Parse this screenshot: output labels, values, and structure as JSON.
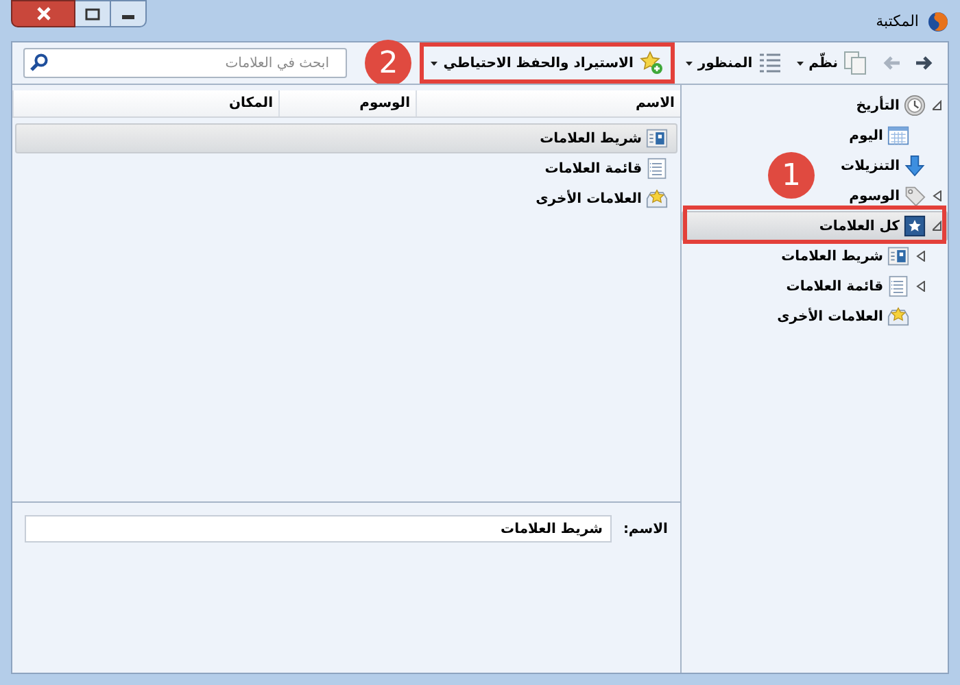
{
  "window": {
    "title": "المكتبة"
  },
  "toolbar": {
    "back": {
      "disabled": false
    },
    "forward": {
      "disabled": true
    },
    "buttons": [
      {
        "kind": "organize",
        "label": "نظّم",
        "has_menu": true
      },
      {
        "kind": "views",
        "label": "المنظور",
        "has_menu": true
      },
      {
        "kind": "import",
        "label": "الاستيراد والحفظ الاحتياطي",
        "has_menu": true
      }
    ],
    "search": {
      "placeholder": "ابحث في العلامات"
    }
  },
  "sidebar": {
    "items": [
      {
        "kind": "history",
        "label": "التأريخ",
        "expanded": true,
        "selected": false,
        "children": [
          {
            "kind": "day",
            "label": "اليوم",
            "selected": false
          }
        ]
      },
      {
        "kind": "downloads",
        "label": "التنزيلات",
        "selected": false
      },
      {
        "kind": "tags",
        "label": "الوسوم",
        "expanded": false,
        "selected": false
      },
      {
        "kind": "all",
        "label": "كل العلامات",
        "expanded": true,
        "selected": true,
        "children": [
          {
            "kind": "toolbar",
            "label": "شريط العلامات",
            "expanded": false,
            "selected": false
          },
          {
            "kind": "menu",
            "label": "قائمة العلامات",
            "expanded": false,
            "selected": false
          },
          {
            "kind": "other",
            "label": "العلامات الأخرى",
            "selected": false
          }
        ]
      }
    ]
  },
  "table": {
    "columns": [
      "الاسم",
      "الوسوم",
      "المكان"
    ],
    "rows": [
      {
        "kind": "toolbar",
        "name": "شريط العلامات",
        "selected": true
      },
      {
        "kind": "menu",
        "name": "قائمة العلامات",
        "selected": false
      },
      {
        "kind": "other",
        "name": "العلامات الأخرى",
        "selected": false
      }
    ]
  },
  "details": {
    "label": "الاسم:",
    "value": "شريط العلامات"
  },
  "annotations": [
    {
      "number": "1"
    },
    {
      "number": "2"
    }
  ]
}
